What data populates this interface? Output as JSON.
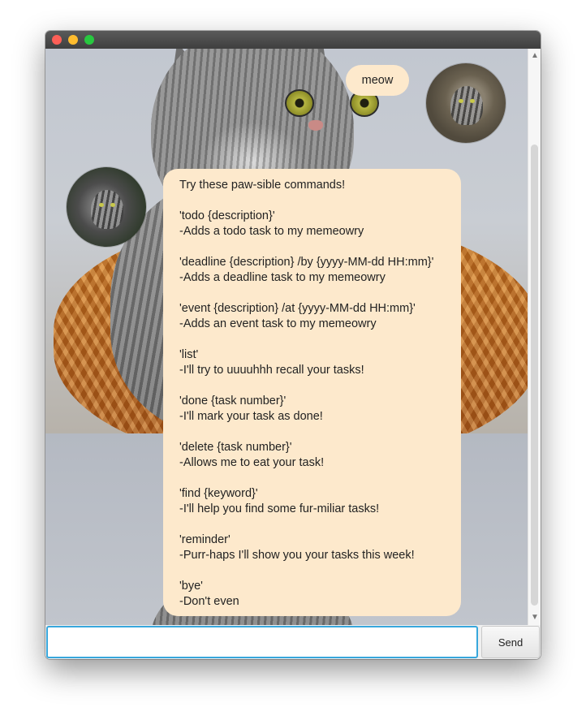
{
  "window": {
    "controls": [
      "close",
      "minimize",
      "maximize"
    ]
  },
  "chat": {
    "user_message": "meow",
    "duke_intro": "Try these paw-sible commands!",
    "commands": [
      {
        "syntax": "'todo {description}'",
        "desc": "-Adds a todo task to my memeowry"
      },
      {
        "syntax": "'deadline {description} /by {yyyy-MM-dd HH:mm}'",
        "desc": "-Adds a deadline task to my memeowry"
      },
      {
        "syntax": "'event {description} /at {yyyy-MM-dd HH:mm}'",
        "desc": "-Adds an event task to my memeowry"
      },
      {
        "syntax": "'list'",
        "desc": "-I'll try to uuuuhhh recall your tasks!"
      },
      {
        "syntax": "'done {task number}'",
        "desc": "-I'll mark your task as done!"
      },
      {
        "syntax": "'delete {task number}'",
        "desc": "-Allows me to eat your task!"
      },
      {
        "syntax": "'find {keyword}'",
        "desc": "-I'll help you find some fur-miliar tasks!"
      },
      {
        "syntax": "'reminder'",
        "desc": "-Purr-haps I'll show you your tasks this week!"
      },
      {
        "syntax": "'bye'",
        "desc": "-Don't even"
      }
    ]
  },
  "input": {
    "value": "",
    "send_label": "Send"
  },
  "colors": {
    "bubble": "#fde9cc",
    "input_focus": "#38a7dc",
    "titlebar": "#474747"
  }
}
